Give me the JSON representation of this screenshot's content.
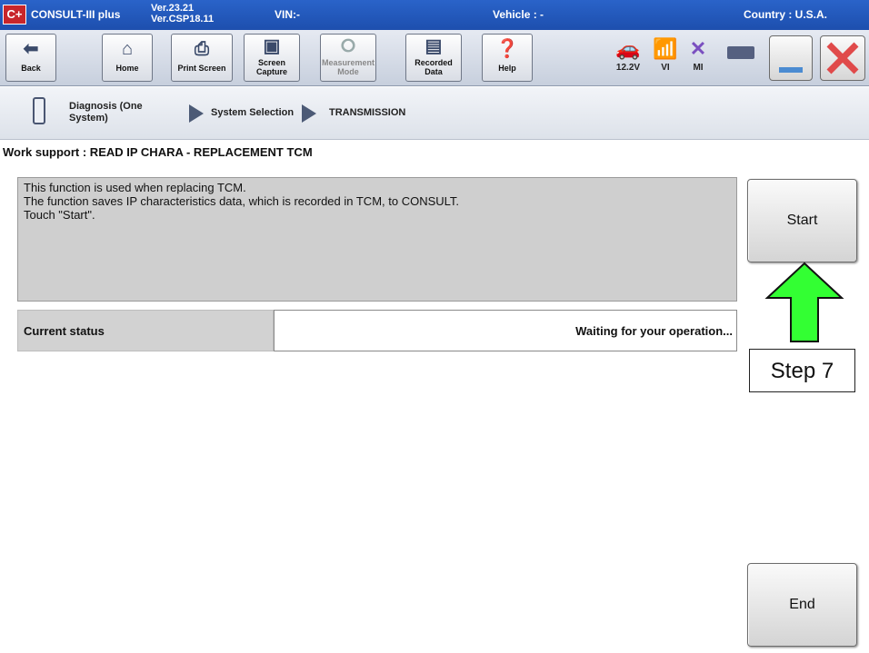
{
  "titlebar": {
    "logo": "C+",
    "app_name": "CONSULT-III plus",
    "version_line1": "Ver.23.21",
    "version_line2": "Ver.CSP18.11",
    "vin": "VIN:-",
    "vehicle": "Vehicle : -",
    "country": "Country : U.S.A."
  },
  "toolbar": {
    "back": "Back",
    "home": "Home",
    "print_screen": "Print Screen",
    "screen_capture_1": "Screen",
    "screen_capture_2": "Capture",
    "measurement_1": "Measurement",
    "measurement_2": "Mode",
    "recorded_1": "Recorded",
    "recorded_2": "Data",
    "help": "Help",
    "voltage": "12.2V",
    "vi": "VI",
    "mi": "MI"
  },
  "breadcrumb": {
    "diag_1": "Diagnosis (One",
    "diag_2": "System)",
    "system_selection": "System Selection",
    "transmission": "TRANSMISSION"
  },
  "work_title": "Work support : READ IP CHARA - REPLACEMENT TCM",
  "message": {
    "line1": "This function is used when replacing TCM.",
    "line2": "The function saves IP characteristics data, which is recorded in TCM, to CONSULT.",
    "line3": "Touch \"Start\"."
  },
  "status": {
    "label": "Current status",
    "value": "Waiting for your operation..."
  },
  "buttons": {
    "start": "Start",
    "end": "End"
  },
  "annotation": {
    "step": "Step 7"
  },
  "colors": {
    "titlebar": "#1d4fae",
    "arrow_fill": "#33ff33"
  }
}
